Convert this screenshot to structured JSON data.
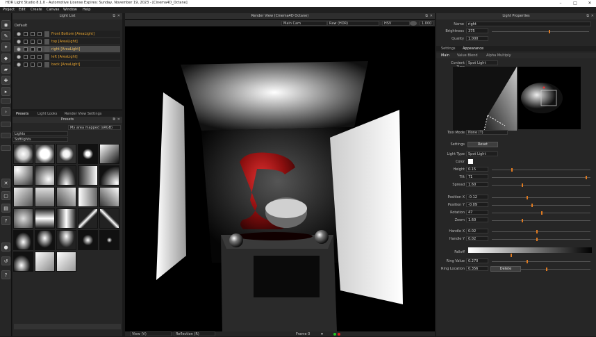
{
  "titlebar": {
    "title": "HDR Light Studio 8.1.0 - Automotive License Expires: Sunday, November 19, 2023 - [Cinema4D_Octane]",
    "min": "–",
    "max": "□",
    "close": "✕"
  },
  "menu": [
    "Project",
    "Edit",
    "Create",
    "Canvas",
    "Window",
    "Help"
  ],
  "lightlist": {
    "title": "Light List",
    "canvas": "Default",
    "items": [
      {
        "label": "Front Bottom [AreaLight]",
        "selected": false
      },
      {
        "label": "top [AreaLight]",
        "selected": false
      },
      {
        "label": "right [AreaLight]",
        "selected": true
      },
      {
        "label": "left [AreaLight]",
        "selected": false
      },
      {
        "label": "back [AreaLight]",
        "selected": false
      }
    ]
  },
  "presets": {
    "tabs": [
      "Presets",
      "Light Looks",
      "Render View Settings"
    ],
    "title": "Presets",
    "dropdown": "My area mapped (sRGB)",
    "category": "Lights",
    "subcategory": "Softlights",
    "tile_count": 28
  },
  "render": {
    "title": "Render View (Cinema4D Octane)",
    "camera": "Main Cam",
    "mode": "Raw (HDR)",
    "colorspace": "HSV",
    "zoom": "1.000",
    "bottom_view": "View (V)",
    "bottom_mode": "Reflection (R)",
    "frame": "Frame 0"
  },
  "props": {
    "title": "Light Properties",
    "name_label": "Name",
    "name_value": "right",
    "brightness_label": "Brightness",
    "brightness_value": "375",
    "quality_label": "Quality",
    "quality_value": "1.000",
    "tabs1": [
      "Settings",
      "Appearance"
    ],
    "tabs2": [
      "Main",
      "Value Blend",
      "Alpha Multiply"
    ],
    "content_label": "Content Type",
    "content_value": "Spot Light",
    "tool_label": "Tool Mode",
    "tool_value": "None (T)",
    "settings_label": "Settings",
    "reset_label": "Reset",
    "lighttype_label": "Light Type",
    "lighttype_value": "Spot Light",
    "color_label": "Color",
    "rows": [
      {
        "label": "Height",
        "value": "0.15"
      },
      {
        "label": "Tilt",
        "value": "71"
      },
      {
        "label": "Spread",
        "value": "1.60"
      }
    ],
    "rows2": [
      {
        "label": "Position X",
        "value": "-0.12"
      },
      {
        "label": "Position Y",
        "value": "-0.09"
      },
      {
        "label": "Rotation",
        "value": "47"
      },
      {
        "label": "Zoom",
        "value": "1.60"
      }
    ],
    "rows3": [
      {
        "label": "Handle X",
        "value": "0.02"
      },
      {
        "label": "Handle Y",
        "value": "0.02"
      }
    ],
    "ramp_label": "Falloff",
    "rowsf": [
      {
        "label": "Ring Value",
        "value": "0.270"
      },
      {
        "label": "Ring Location",
        "value": "0.356"
      }
    ],
    "delete_label": "Delete"
  },
  "colors": {
    "accent": "#e07a20",
    "list_text": "#e8a530"
  }
}
